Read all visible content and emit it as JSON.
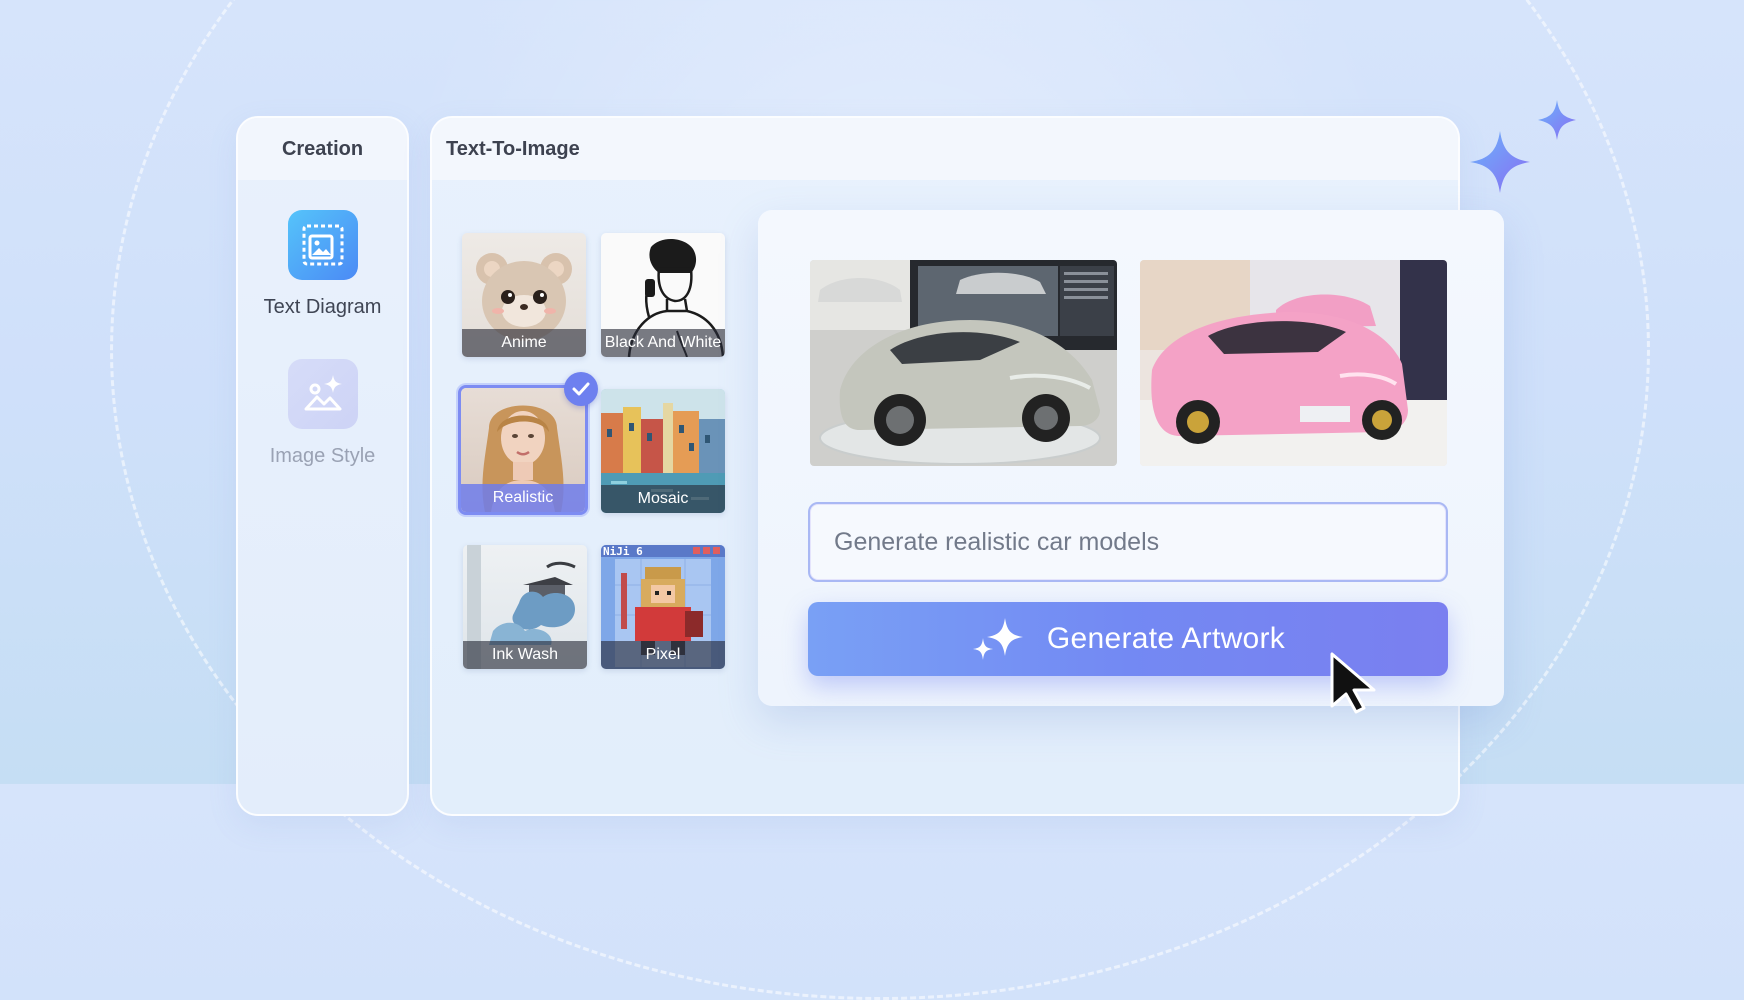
{
  "sidebar": {
    "title": "Creation",
    "items": [
      {
        "label": "Text Diagram",
        "icon": "image-frame-icon",
        "active": true
      },
      {
        "label": "Image Style",
        "icon": "image-sparkle-icon",
        "active": false
      }
    ]
  },
  "main": {
    "title": "Text-To-Image",
    "styles": [
      {
        "label": "Anime",
        "selected": false
      },
      {
        "label": "Black And White",
        "selected": false
      },
      {
        "label": "Realistic",
        "selected": true
      },
      {
        "label": "Mosaic",
        "selected": false
      },
      {
        "label": "Ink Wash",
        "selected": false
      },
      {
        "label": "Pixel",
        "selected": false
      }
    ],
    "pixel_badge": "NiJi 6"
  },
  "generator": {
    "prompt_value": "Generate realistic car models",
    "button_label": "Generate Artwork",
    "images": [
      {
        "icon": "silver-car-image"
      },
      {
        "icon": "pink-car-image"
      }
    ]
  },
  "colors": {
    "accent": "#6e80ef",
    "button_start": "#79a0f5",
    "button_end": "#7a7ff0",
    "sidebar_active": "#4b8af5"
  }
}
